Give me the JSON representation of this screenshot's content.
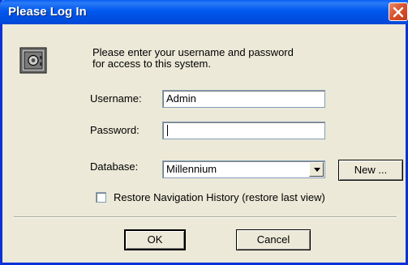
{
  "window": {
    "title": "Please Log In"
  },
  "icons": {
    "app": "safe-icon",
    "close": "close-icon",
    "dropdown": "chevron-down-icon"
  },
  "message": {
    "line1": "Please enter your username and password",
    "line2": "for access to this system."
  },
  "username": {
    "label": "Username:",
    "value": "Admin"
  },
  "password": {
    "label": "Password:",
    "value": ""
  },
  "database": {
    "label": "Database:",
    "selected": "Millennium",
    "new_button": "New ..."
  },
  "restore": {
    "label": "Restore Navigation History (restore last view)",
    "checked": false
  },
  "buttons": {
    "ok": "OK",
    "cancel": "Cancel"
  },
  "colors": {
    "titlebar": "#0058ee",
    "close": "#d9542f",
    "dialog_bg": "#ece9d8"
  }
}
